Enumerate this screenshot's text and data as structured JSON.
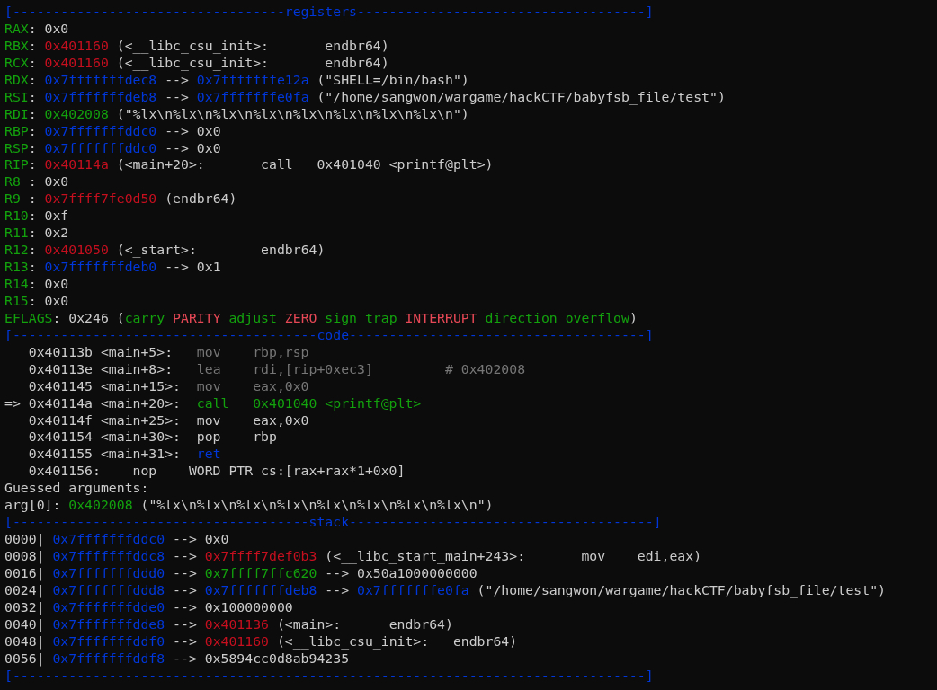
{
  "terminal": {
    "lines": [
      [
        {
          "text": "[----------------------------------registers------------------------------------]",
          "color": "#0037da"
        }
      ],
      [
        {
          "text": "RAX",
          "color": "#13a10e"
        },
        {
          "text": ": 0x0",
          "color": "#cccccc"
        }
      ],
      [
        {
          "text": "RBX",
          "color": "#13a10e"
        },
        {
          "text": ": ",
          "color": "#cccccc"
        },
        {
          "text": "0x401160",
          "color": "#c50f1f"
        },
        {
          "text": " (<__libc_csu_init>:       endbr64)",
          "color": "#cccccc"
        }
      ],
      [
        {
          "text": "RCX",
          "color": "#13a10e"
        },
        {
          "text": ": ",
          "color": "#cccccc"
        },
        {
          "text": "0x401160",
          "color": "#c50f1f"
        },
        {
          "text": " (<__libc_csu_init>:       endbr64)",
          "color": "#cccccc"
        }
      ],
      [
        {
          "text": "RDX",
          "color": "#13a10e"
        },
        {
          "text": ": ",
          "color": "#cccccc"
        },
        {
          "text": "0x7fffffffdec8",
          "color": "#0037da"
        },
        {
          "text": " --> ",
          "color": "#cccccc"
        },
        {
          "text": "0x7fffffffe12a",
          "color": "#0037da"
        },
        {
          "text": " (\"SHELL=/bin/bash\")",
          "color": "#cccccc"
        }
      ],
      [
        {
          "text": "RSI",
          "color": "#13a10e"
        },
        {
          "text": ": ",
          "color": "#cccccc"
        },
        {
          "text": "0x7fffffffdeb8",
          "color": "#0037da"
        },
        {
          "text": " --> ",
          "color": "#cccccc"
        },
        {
          "text": "0x7fffffffe0fa",
          "color": "#0037da"
        },
        {
          "text": " (\"/home/sangwon/wargame/hackCTF/babyfsb_file/test\")",
          "color": "#cccccc"
        }
      ],
      [
        {
          "text": "RDI",
          "color": "#13a10e"
        },
        {
          "text": ": ",
          "color": "#cccccc"
        },
        {
          "text": "0x402008",
          "color": "#13a10e"
        },
        {
          "text": " (\"%lx\\n%lx\\n%lx\\n%lx\\n%lx\\n%lx\\n%lx\\n%lx\\n\")",
          "color": "#cccccc"
        }
      ],
      [
        {
          "text": "RBP",
          "color": "#13a10e"
        },
        {
          "text": ": ",
          "color": "#cccccc"
        },
        {
          "text": "0x7fffffffddc0",
          "color": "#0037da"
        },
        {
          "text": " --> 0x0",
          "color": "#cccccc"
        }
      ],
      [
        {
          "text": "RSP",
          "color": "#13a10e"
        },
        {
          "text": ": ",
          "color": "#cccccc"
        },
        {
          "text": "0x7fffffffddc0",
          "color": "#0037da"
        },
        {
          "text": " --> 0x0",
          "color": "#cccccc"
        }
      ],
      [
        {
          "text": "RIP",
          "color": "#13a10e"
        },
        {
          "text": ": ",
          "color": "#cccccc"
        },
        {
          "text": "0x40114a",
          "color": "#c50f1f"
        },
        {
          "text": " (<main+20>:       call   0x401040 <printf@plt>)",
          "color": "#cccccc"
        }
      ],
      [
        {
          "text": "R8 ",
          "color": "#13a10e"
        },
        {
          "text": ": 0x0",
          "color": "#cccccc"
        }
      ],
      [
        {
          "text": "R9 ",
          "color": "#13a10e"
        },
        {
          "text": ": ",
          "color": "#cccccc"
        },
        {
          "text": "0x7ffff7fe0d50",
          "color": "#c50f1f"
        },
        {
          "text": " (endbr64)",
          "color": "#cccccc"
        }
      ],
      [
        {
          "text": "R10",
          "color": "#13a10e"
        },
        {
          "text": ": 0xf",
          "color": "#cccccc"
        }
      ],
      [
        {
          "text": "R11",
          "color": "#13a10e"
        },
        {
          "text": ": 0x2",
          "color": "#cccccc"
        }
      ],
      [
        {
          "text": "R12",
          "color": "#13a10e"
        },
        {
          "text": ": ",
          "color": "#cccccc"
        },
        {
          "text": "0x401050",
          "color": "#c50f1f"
        },
        {
          "text": " (<_start>:        endbr64)",
          "color": "#cccccc"
        }
      ],
      [
        {
          "text": "R13",
          "color": "#13a10e"
        },
        {
          "text": ": ",
          "color": "#cccccc"
        },
        {
          "text": "0x7fffffffdeb0",
          "color": "#0037da"
        },
        {
          "text": " --> 0x1",
          "color": "#cccccc"
        }
      ],
      [
        {
          "text": "R14",
          "color": "#13a10e"
        },
        {
          "text": ": 0x0",
          "color": "#cccccc"
        }
      ],
      [
        {
          "text": "R15",
          "color": "#13a10e"
        },
        {
          "text": ": 0x0",
          "color": "#cccccc"
        }
      ],
      [
        {
          "text": "EFLAGS",
          "color": "#13a10e"
        },
        {
          "text": ": 0x246 (",
          "color": "#cccccc"
        },
        {
          "text": "carry ",
          "color": "#13a10e"
        },
        {
          "text": "PARITY ",
          "color": "#e74856"
        },
        {
          "text": "adjust ",
          "color": "#13a10e"
        },
        {
          "text": "ZERO ",
          "color": "#e74856"
        },
        {
          "text": "sign trap ",
          "color": "#13a10e"
        },
        {
          "text": "INTERRUPT ",
          "color": "#e74856"
        },
        {
          "text": "direction overflow",
          "color": "#13a10e"
        },
        {
          "text": ")",
          "color": "#cccccc"
        }
      ],
      [
        {
          "text": "[--------------------------------------code-------------------------------------]",
          "color": "#0037da"
        }
      ],
      [
        {
          "text": "   0x40113b <main+5>:   ",
          "color": "#cccccc"
        },
        {
          "text": "mov    rbp,rsp",
          "color": "#767676"
        }
      ],
      [
        {
          "text": "   0x40113e <main+8>:   ",
          "color": "#cccccc"
        },
        {
          "text": "lea    rdi,[rip+0xec3]         # 0x402008",
          "color": "#767676"
        }
      ],
      [
        {
          "text": "   0x401145 <main+15>:  ",
          "color": "#cccccc"
        },
        {
          "text": "mov    eax,0x0",
          "color": "#767676"
        }
      ],
      [
        {
          "text": "=> 0x40114a <main+20>:  ",
          "color": "#cccccc"
        },
        {
          "text": "call   0x401040 <printf@plt>",
          "color": "#13a10e"
        }
      ],
      [
        {
          "text": "   0x40114f <main+25>:  mov    eax,0x0",
          "color": "#cccccc"
        }
      ],
      [
        {
          "text": "   0x401154 <main+30>:  pop    rbp",
          "color": "#cccccc"
        }
      ],
      [
        {
          "text": "   0x401155 <main+31>:  ",
          "color": "#cccccc"
        },
        {
          "text": "ret",
          "color": "#0037da"
        }
      ],
      [
        {
          "text": "   0x401156:    nop    WORD PTR cs:[rax+rax*1+0x0]",
          "color": "#cccccc"
        }
      ],
      [
        {
          "text": "Guessed arguments:",
          "color": "#cccccc"
        }
      ],
      [
        {
          "text": "arg[0]: ",
          "color": "#cccccc"
        },
        {
          "text": "0x402008",
          "color": "#13a10e"
        },
        {
          "text": " (\"%lx\\n%lx\\n%lx\\n%lx\\n%lx\\n%lx\\n%lx\\n%lx\\n\")",
          "color": "#cccccc"
        }
      ],
      [
        {
          "text": "[-------------------------------------stack--------------------------------------]",
          "color": "#0037da"
        }
      ],
      [
        {
          "text": "0000| ",
          "color": "#cccccc"
        },
        {
          "text": "0x7fffffffddc0",
          "color": "#0037da"
        },
        {
          "text": " --> 0x0",
          "color": "#cccccc"
        }
      ],
      [
        {
          "text": "0008| ",
          "color": "#cccccc"
        },
        {
          "text": "0x7fffffffddc8",
          "color": "#0037da"
        },
        {
          "text": " --> ",
          "color": "#cccccc"
        },
        {
          "text": "0x7ffff7def0b3",
          "color": "#c50f1f"
        },
        {
          "text": " (<__libc_start_main+243>:       mov    edi,eax)",
          "color": "#cccccc"
        }
      ],
      [
        {
          "text": "0016| ",
          "color": "#cccccc"
        },
        {
          "text": "0x7fffffffddd0",
          "color": "#0037da"
        },
        {
          "text": " --> ",
          "color": "#cccccc"
        },
        {
          "text": "0x7ffff7ffc620",
          "color": "#13a10e"
        },
        {
          "text": " --> 0x50a1000000000",
          "color": "#cccccc"
        }
      ],
      [
        {
          "text": "0024| ",
          "color": "#cccccc"
        },
        {
          "text": "0x7fffffffddd8",
          "color": "#0037da"
        },
        {
          "text": " --> ",
          "color": "#cccccc"
        },
        {
          "text": "0x7fffffffdeb8",
          "color": "#0037da"
        },
        {
          "text": " --> ",
          "color": "#cccccc"
        },
        {
          "text": "0x7fffffffe0fa",
          "color": "#0037da"
        },
        {
          "text": " (\"/home/sangwon/wargame/hackCTF/babyfsb_file/test\")",
          "color": "#cccccc"
        }
      ],
      [
        {
          "text": "0032| ",
          "color": "#cccccc"
        },
        {
          "text": "0x7fffffffdde0",
          "color": "#0037da"
        },
        {
          "text": " --> 0x100000000",
          "color": "#cccccc"
        }
      ],
      [
        {
          "text": "0040| ",
          "color": "#cccccc"
        },
        {
          "text": "0x7fffffffdde8",
          "color": "#0037da"
        },
        {
          "text": " --> ",
          "color": "#cccccc"
        },
        {
          "text": "0x401136",
          "color": "#c50f1f"
        },
        {
          "text": " (<main>:      endbr64)",
          "color": "#cccccc"
        }
      ],
      [
        {
          "text": "0048| ",
          "color": "#cccccc"
        },
        {
          "text": "0x7fffffffddf0",
          "color": "#0037da"
        },
        {
          "text": " --> ",
          "color": "#cccccc"
        },
        {
          "text": "0x401160",
          "color": "#c50f1f"
        },
        {
          "text": " (<__libc_csu_init>:   endbr64)",
          "color": "#cccccc"
        }
      ],
      [
        {
          "text": "0056| ",
          "color": "#cccccc"
        },
        {
          "text": "0x7fffffffddf8",
          "color": "#0037da"
        },
        {
          "text": " --> 0x5894cc0d8ab94235",
          "color": "#cccccc"
        }
      ],
      [
        {
          "text": "[-------------------------------------------------------------------------------]",
          "color": "#0037da"
        }
      ]
    ]
  }
}
